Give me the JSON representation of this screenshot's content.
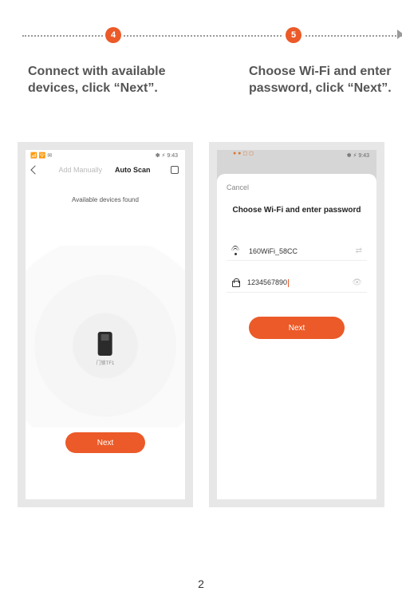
{
  "steps": {
    "badge4": "4",
    "badge5": "5"
  },
  "captions": {
    "left": "Connect with available devices, click “Next”.",
    "right": "Choose Wi-Fi and enter password, click “Next”."
  },
  "phone1": {
    "status_left": "••",
    "status_right": "9:43",
    "tab_manual": "Add Manually",
    "tab_auto": "Auto Scan",
    "subheader": "Available devices found",
    "device_label": "门锁TF1",
    "next_label": "Next"
  },
  "phone2": {
    "status_left": "••",
    "status_right": "9:43",
    "cancel": "Cancel",
    "title": "Choose Wi-Fi and enter password",
    "ssid": "160WiFi_58CC",
    "password": "1234567890",
    "next_label": "Next"
  },
  "page_number": "2"
}
